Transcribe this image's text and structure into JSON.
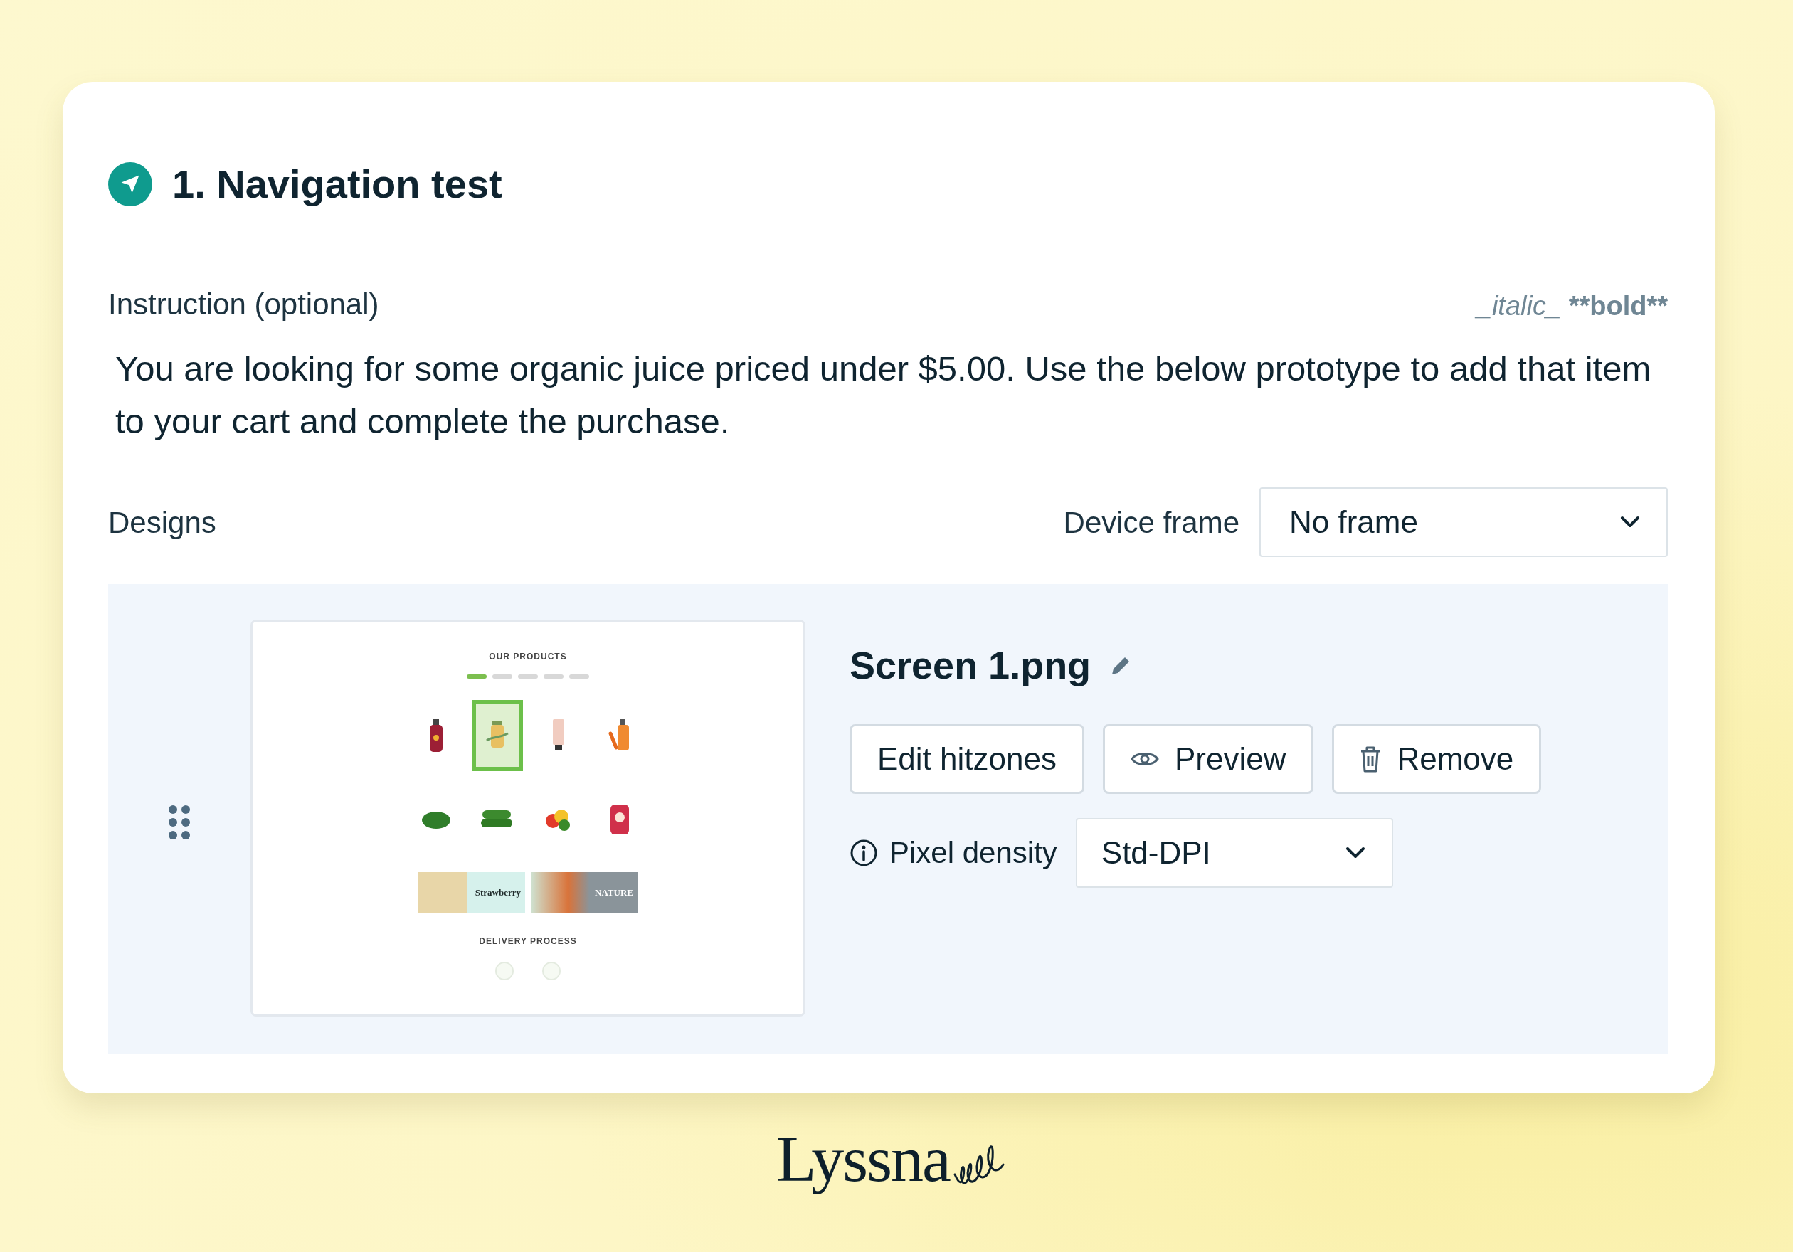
{
  "task": {
    "title": "1. Navigation test"
  },
  "instruction": {
    "label": "Instruction (optional)",
    "format_hint": [
      {
        "text": "_italic_",
        "kind": "italic"
      },
      {
        "text": "**bold**",
        "kind": "bold"
      }
    ],
    "text": "You are looking for some organic juice priced under $5.00. Use the below prototype to add that item to your cart and complete the purchase."
  },
  "designs": {
    "label": "Designs",
    "device_frame": {
      "label": "Device frame",
      "value": "No frame"
    },
    "items": [
      {
        "file_name": "Screen 1.png",
        "buttons": [
          {
            "label": "Edit hitzones"
          },
          {
            "label": "Preview",
            "kind": "eye"
          },
          {
            "label": "Remove",
            "kind": "trash"
          }
        ],
        "pixel_density": {
          "label": "Pixel density",
          "value": "Std-DPI"
        },
        "thumbnail": {
          "heading": "OUR PRODUCTS",
          "products": [
            {
              "kind": "bottle",
              "selected": false
            },
            {
              "kind": "jar",
              "selected": true
            },
            {
              "kind": "tube",
              "selected": false
            },
            {
              "kind": "juice",
              "selected": false
            },
            {
              "kind": "greens",
              "selected": false
            },
            {
              "kind": "cucumber",
              "selected": false
            },
            {
              "kind": "peppers",
              "selected": false
            },
            {
              "kind": "pouch",
              "selected": false
            }
          ],
          "banners": [
            {
              "text": "Strawberry",
              "kind": "strawberry"
            },
            {
              "text": "NATURE",
              "kind": "nature"
            }
          ],
          "section_heading": "DELIVERY PROCESS"
        }
      }
    ]
  },
  "footer": {
    "brand": "Lyssna"
  }
}
